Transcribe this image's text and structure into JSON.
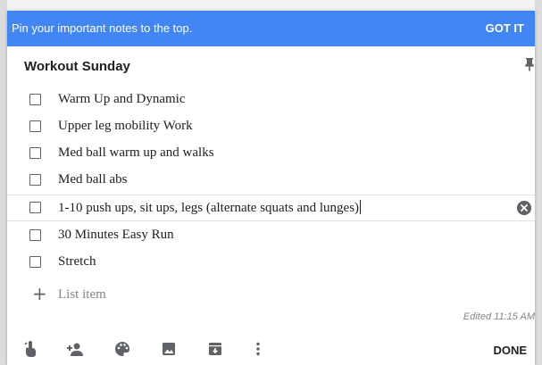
{
  "banner": {
    "message": "Pin your important notes to the top.",
    "action_label": "GOT IT",
    "color": "#4285f4"
  },
  "note": {
    "title": "Workout Sunday",
    "pin_icon": "pin-icon",
    "items": [
      {
        "label": "Warm Up and Dynamic",
        "checked": false
      },
      {
        "label": "Upper leg mobility Work",
        "checked": false
      },
      {
        "label": "Med ball warm up and walks",
        "checked": false
      },
      {
        "label": "Med ball abs",
        "checked": false
      },
      {
        "label": "1-10 push ups, sit ups, legs (alternate squats and lunges)",
        "checked": false,
        "editing": true
      },
      {
        "label": "30 Minutes Easy Run",
        "checked": false
      },
      {
        "label": "Stretch",
        "checked": false
      }
    ],
    "add_item_placeholder": "List item",
    "edited_text": "Edited 11:15 AM"
  },
  "toolbar": {
    "icons": [
      "reminder-icon",
      "collaborator-icon",
      "color-palette-icon",
      "image-icon",
      "archive-icon",
      "more-vert-icon"
    ],
    "done_label": "DONE"
  }
}
